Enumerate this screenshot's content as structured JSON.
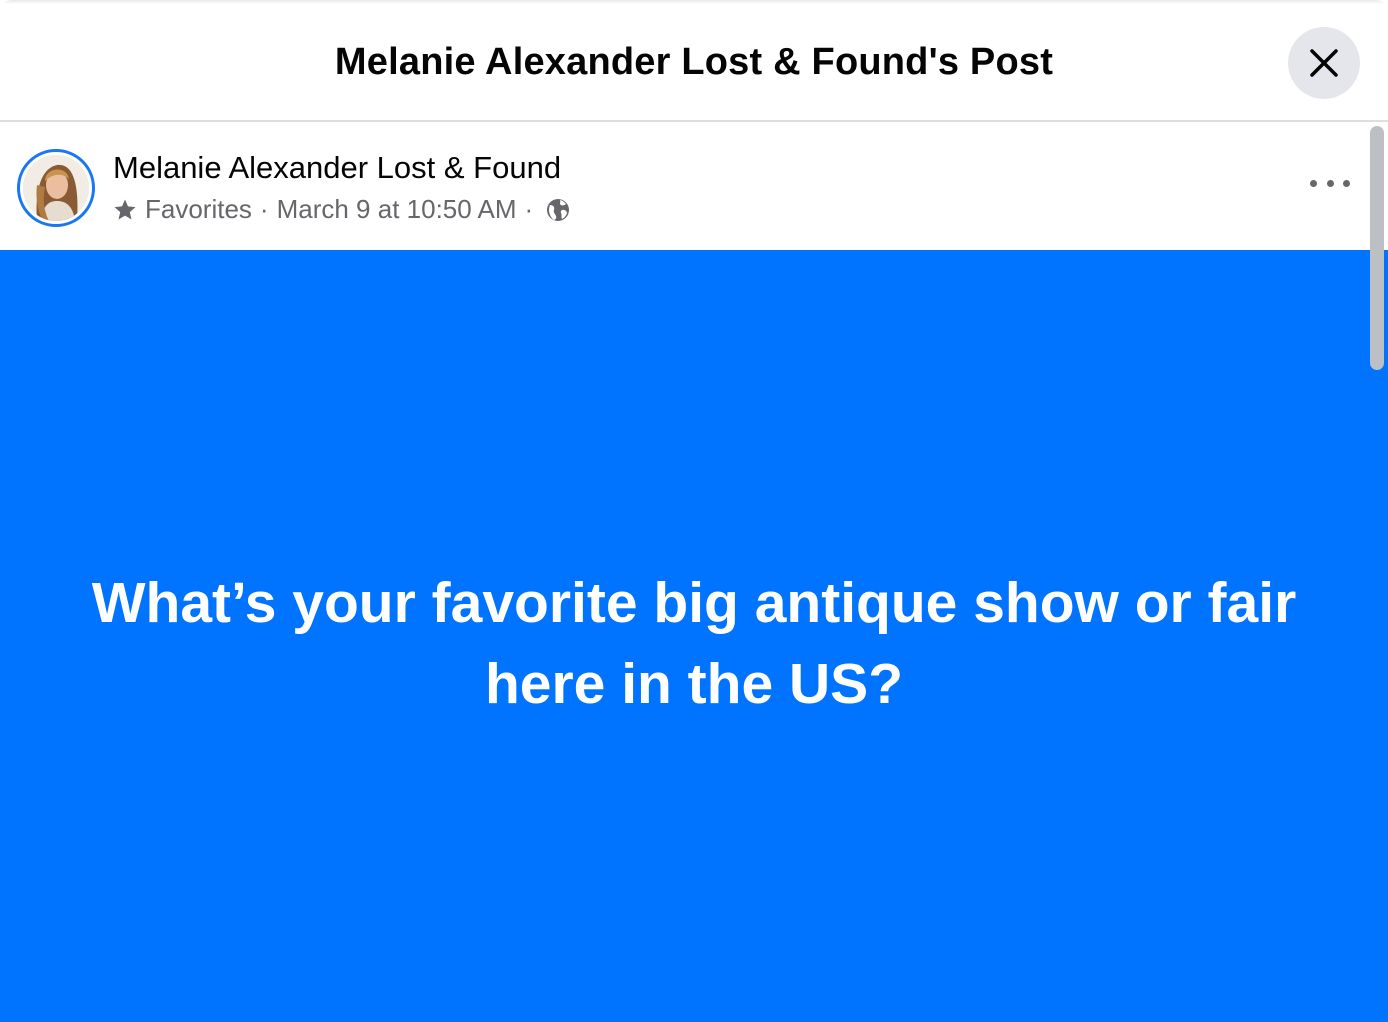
{
  "modal": {
    "title": "Melanie Alexander Lost & Found's Post",
    "close_icon": "close-icon"
  },
  "post": {
    "author": "Melanie Alexander Lost & Found",
    "audience_icon": "star-icon",
    "audience_label": "Favorites",
    "separator": "·",
    "timestamp": "March 9 at 10:50 AM",
    "privacy_icon": "globe-icon",
    "more_icon": "more-options-icon",
    "text": "What’s your favorite big antique show or fair here in the US?",
    "background_color": "#0073ff"
  },
  "colors": {
    "accent": "#1877f2",
    "secondary_text": "#65676b",
    "primary_text": "#050505"
  }
}
